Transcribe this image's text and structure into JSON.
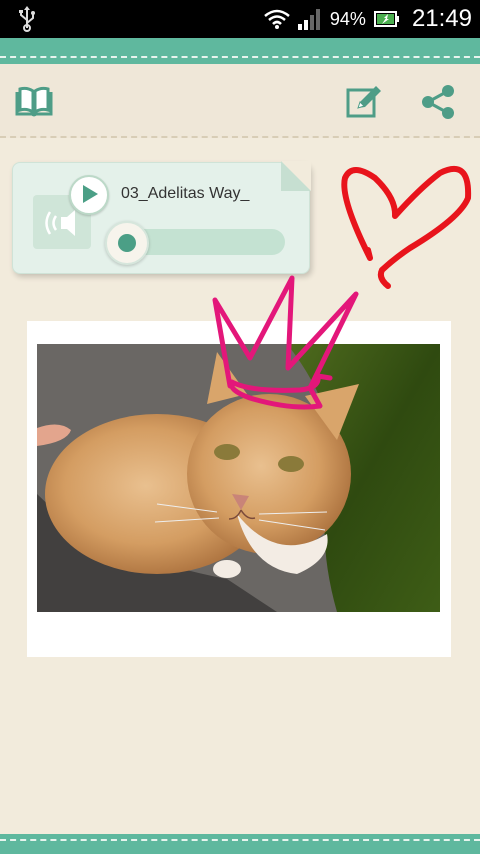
{
  "status_bar": {
    "usb_icon": "usb-icon",
    "wifi_icon": "wifi-icon",
    "signal_icon": "signal-icon",
    "battery_percent": "94%",
    "battery_icon": "battery-charging-icon",
    "time": "21:49"
  },
  "toolbar": {
    "left_icon": "book-icon",
    "edit_icon": "edit-icon",
    "share_icon": "share-icon"
  },
  "audio_player": {
    "track_name": "03_Adelitas Way_",
    "progress_fraction": 0.0,
    "play_icon": "play-icon",
    "speaker_icon": "speaker-icon"
  },
  "photo": {
    "description_icon": "cat-photo"
  },
  "doodles": {
    "heart_color": "#e8141c",
    "crown_color": "#e3177a"
  },
  "colors": {
    "accent": "#5fb89e",
    "background": "#f2ebdc"
  }
}
